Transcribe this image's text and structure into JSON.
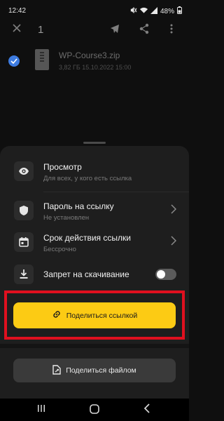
{
  "status_bar": {
    "time": "12:42",
    "battery": "48%"
  },
  "toolbar": {
    "selected_count": "1"
  },
  "file": {
    "name": "WP-Course3.zip",
    "meta": "3,82 ГБ 15.10.2022 15:00"
  },
  "options": [
    {
      "title": "Просмотр",
      "subtitle": "Для всех, у кого есть ссылка",
      "icon": "eye-icon"
    },
    {
      "title": "Пароль на ссылку",
      "subtitle": "Не установлен",
      "icon": "shield-icon"
    },
    {
      "title": "Срок действия ссылки",
      "subtitle": "Бессрочно",
      "icon": "calendar-icon"
    },
    {
      "title": "Запрет на скачивание",
      "icon": "download-icon",
      "toggle_on": false
    }
  ],
  "buttons": {
    "share_link": "Поделиться ссылкой",
    "share_file": "Поделиться файлом"
  },
  "colors": {
    "accent": "#fccb14",
    "highlight": "#e0101f",
    "check": "#3d7be0"
  }
}
